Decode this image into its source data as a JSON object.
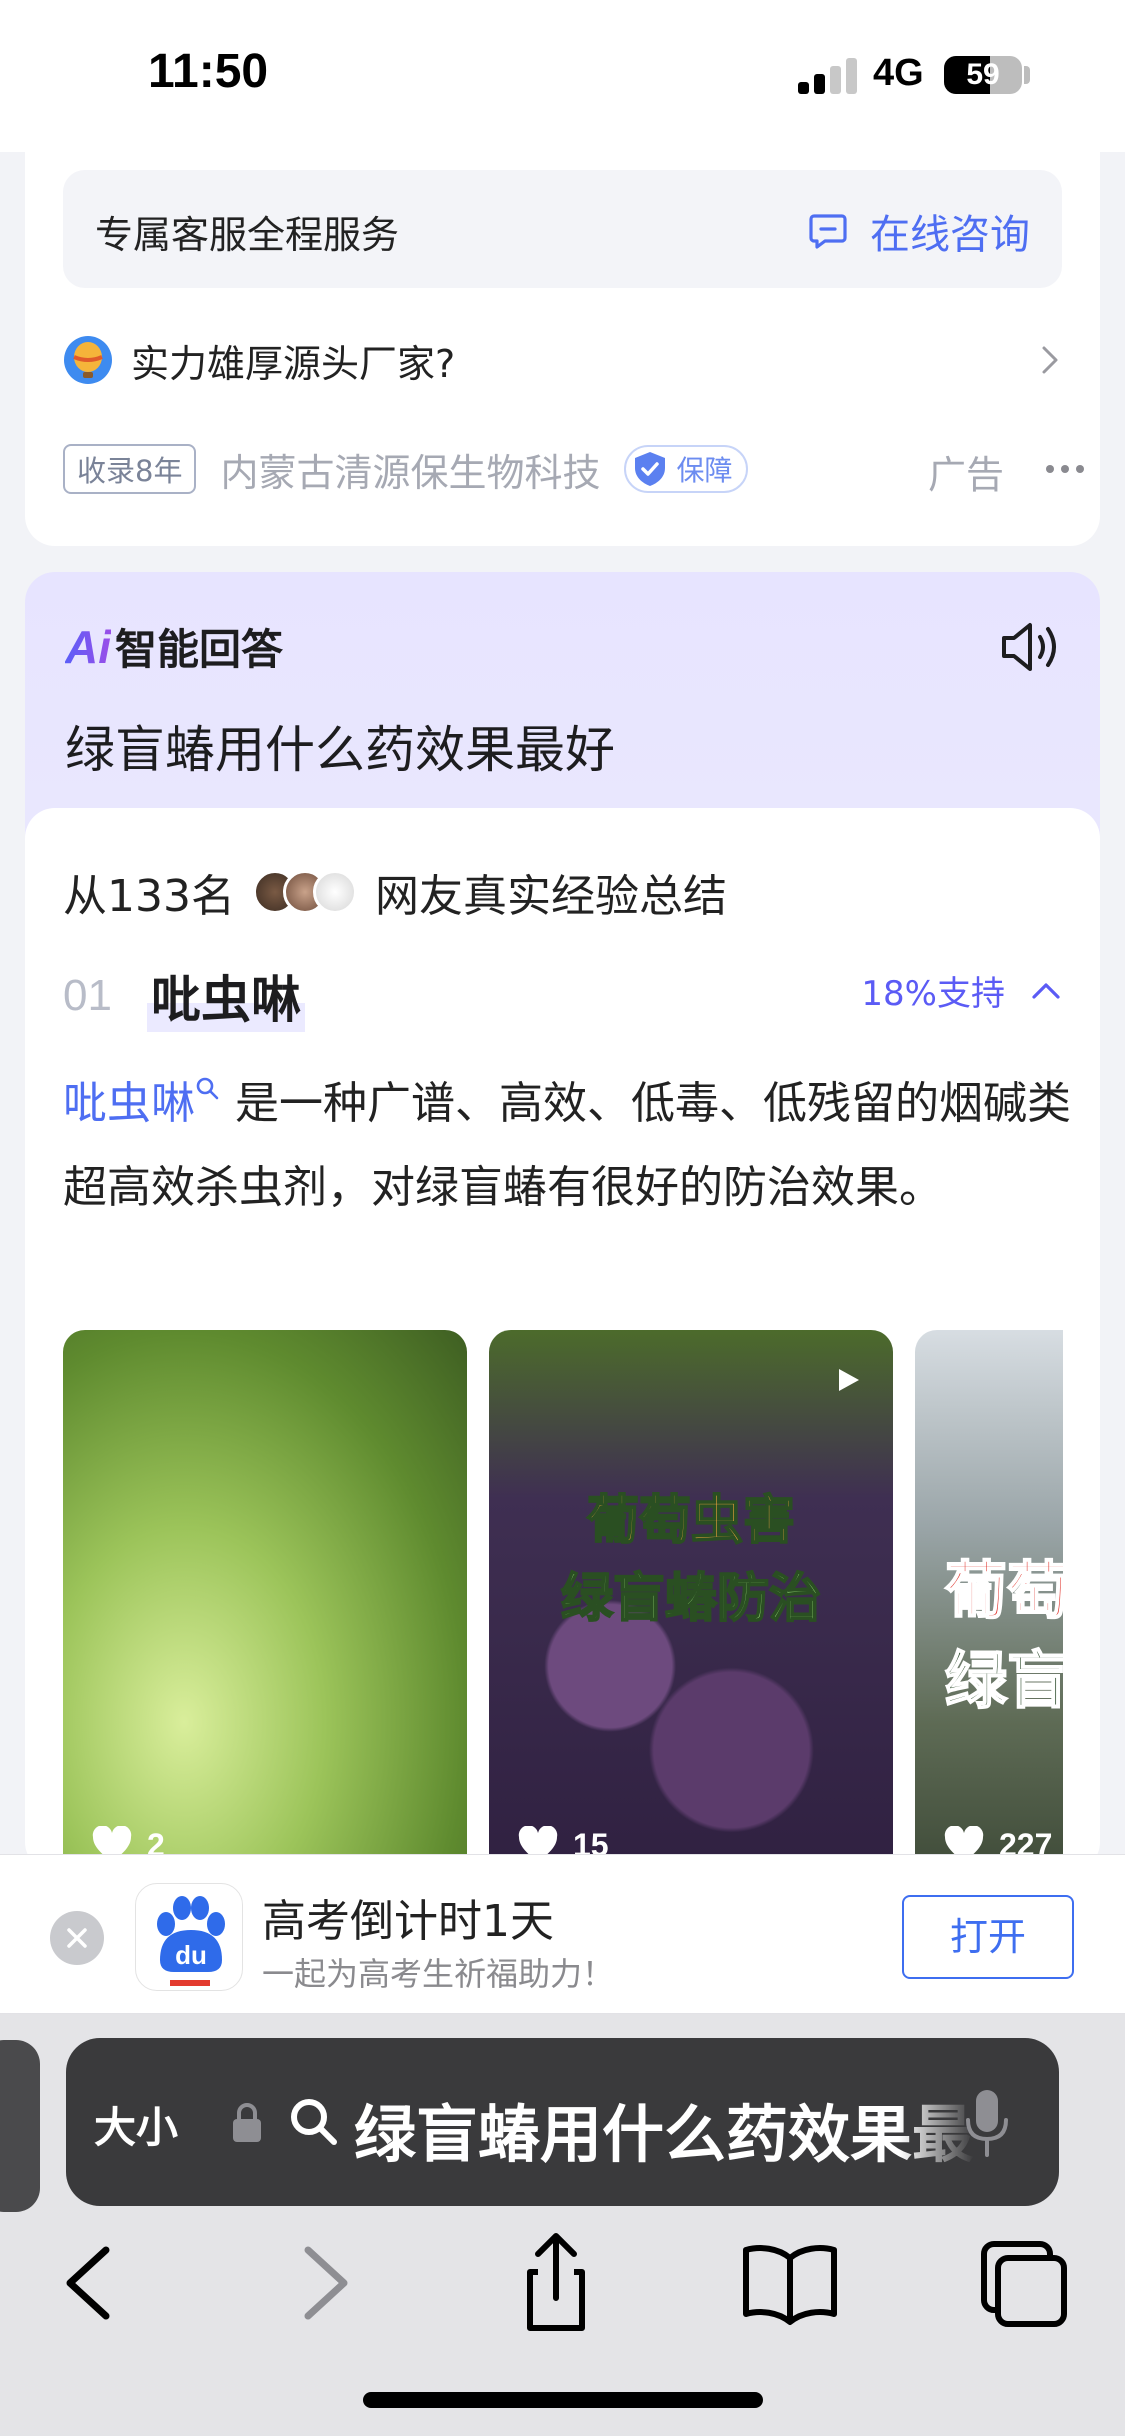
{
  "status_bar": {
    "time": "11:50",
    "network": "4G",
    "battery": "59",
    "battery_level": 0.59
  },
  "ad_card": {
    "service_label": "专属客服全程服务",
    "consult_label": "在线咨询",
    "factory_question": "实力雄厚源头厂家?",
    "years_badge": "收录8年",
    "company": "内蒙古清源保生物科技",
    "guarantee": "保障",
    "ad_label": "广告"
  },
  "ai_card": {
    "logo": "Ai",
    "title": "智能回答",
    "question": "绿盲蝽用什么药效果最好",
    "summary_prefix": "从133名",
    "summary_suffix": "网友真实经验总结",
    "item": {
      "number": "01",
      "name": "吡虫啉",
      "support": "18%支持",
      "desc_link": "吡虫啉",
      "desc_text": "是一种广谱、高效、低毒、低残留的烟碱类超高效杀虫剂，对绿盲蝽有很好的防治效果。"
    },
    "thumbnails": [
      {
        "likes": "2"
      },
      {
        "likes": "15",
        "caption1": "葡萄虫害",
        "caption2": "绿盲蝽防治"
      },
      {
        "likes": "227",
        "caption1": "葡萄",
        "caption2": "绿盲"
      }
    ]
  },
  "app_banner": {
    "title": "高考倒计时1天",
    "subtitle": "一起为高考生祈福助力！",
    "open_label": "打开",
    "app_icon_text": "du"
  },
  "safari": {
    "text_size_label": "大小",
    "query": "绿盲蝽用什么药效果最好"
  }
}
